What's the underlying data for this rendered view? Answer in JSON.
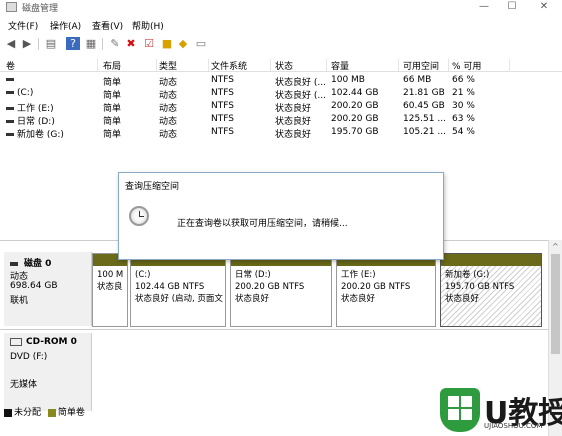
{
  "window": {
    "title": "磁盘管理"
  },
  "menu": [
    "文件(F)",
    "操作(A)",
    "查看(V)",
    "帮助(H)"
  ],
  "table": {
    "headers": [
      "卷",
      "布局",
      "类型",
      "文件系统",
      "状态",
      "容量",
      "可用空间",
      "% 可用"
    ],
    "rows": [
      [
        "",
        "简单",
        "动态",
        "NTFS",
        "状态良好 (...",
        "100 MB",
        "66 MB",
        "66 %"
      ],
      [
        "(C:)",
        "简单",
        "动态",
        "NTFS",
        "状态良好 (...",
        "102.44 GB",
        "21.81 GB",
        "21 %"
      ],
      [
        "工作 (E:)",
        "简单",
        "动态",
        "NTFS",
        "状态良好",
        "200.20 GB",
        "60.45 GB",
        "30 %"
      ],
      [
        "日常 (D:)",
        "简单",
        "动态",
        "NTFS",
        "状态良好",
        "200.20 GB",
        "125.51 ...",
        "63 %"
      ],
      [
        "新加卷 (G:)",
        "简单",
        "动态",
        "NTFS",
        "状态良好",
        "195.70 GB",
        "105.21 ...",
        "54 %"
      ]
    ]
  },
  "dialog": {
    "title": "查询压缩空间",
    "message": "正在查询卷以获取可用压缩空间，请稍候..."
  },
  "disk0": {
    "name": "磁盘 0",
    "type": "动态",
    "size": "698.64 GB",
    "status": "联机",
    "partitions": [
      {
        "line1": "",
        "line2": "100 M",
        "line3": "状态良"
      },
      {
        "line1": "(C:)",
        "line2": "102.44 GB NTFS",
        "line3": "状态良好 (启动, 页面文"
      },
      {
        "line1": "日常  (D:)",
        "line2": "200.20 GB NTFS",
        "line3": "状态良好"
      },
      {
        "line1": "工作  (E:)",
        "line2": "200.20 GB NTFS",
        "line3": "状态良好"
      },
      {
        "line1": "新加卷  (G:)",
        "line2": "195.70 GB NTFS",
        "line3": "状态良好"
      }
    ]
  },
  "cdrom": {
    "name": "CD-ROM 0",
    "drive": "DVD (F:)",
    "media": "无媒体"
  },
  "legend": {
    "unallocated": "未分配",
    "simple": "简单卷",
    "unallocated_color": "#111111",
    "simple_color": "#8a8a1c"
  },
  "watermark": {
    "brand": "U教授",
    "site": "UJIAOSHOU.COM"
  }
}
